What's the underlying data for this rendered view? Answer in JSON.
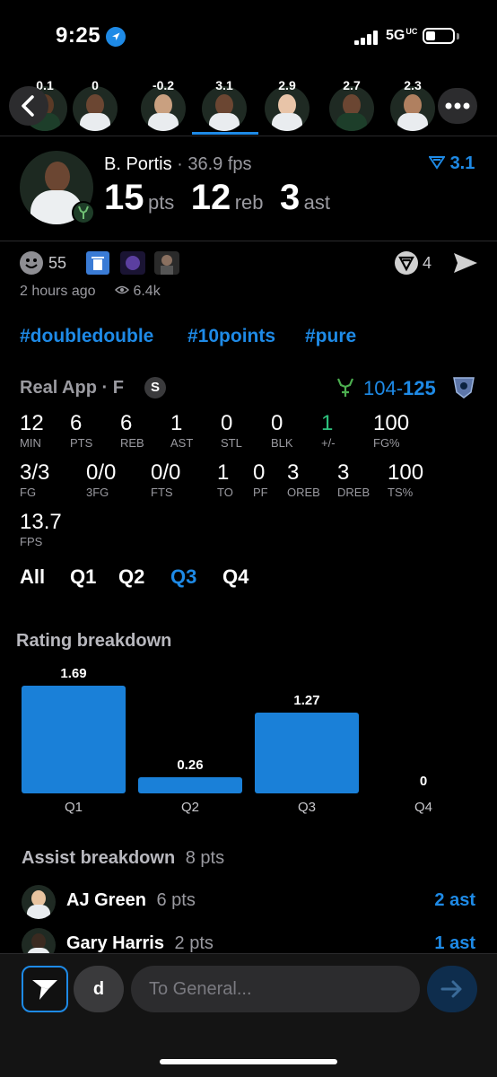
{
  "status_bar": {
    "time": "9:25",
    "network": "5G",
    "network_suffix": "UC"
  },
  "player_strip": {
    "values": [
      "0.1",
      "0",
      "-0.2",
      "3.1",
      "2.9",
      "2.7",
      "2.3"
    ],
    "active_index": 3
  },
  "player": {
    "name": "B. Portis",
    "separator": "·",
    "fps": "36.9 fps",
    "rating": "3.1",
    "pts_value": "15",
    "pts_label": "pts",
    "reb_value": "12",
    "reb_label": "reb",
    "ast_value": "3",
    "ast_label": "ast"
  },
  "social": {
    "reactions_count": "55",
    "shares_count": "4",
    "posted": "2 hours ago",
    "views": "6.4k"
  },
  "hashtags": [
    "#doubledouble",
    "#10points",
    "#pure"
  ],
  "game": {
    "league": "Real App",
    "separator": "·",
    "position": "F",
    "badge": "S",
    "score_home": "104",
    "score_dash": "-",
    "score_away": "125"
  },
  "stats_row1": [
    {
      "value": "12",
      "label": "MIN"
    },
    {
      "value": "6",
      "label": "PTS"
    },
    {
      "value": "6",
      "label": "REB"
    },
    {
      "value": "1",
      "label": "AST"
    },
    {
      "value": "0",
      "label": "STL"
    },
    {
      "value": "0",
      "label": "BLK"
    },
    {
      "value": "1",
      "label": "+/-"
    },
    {
      "value": "100",
      "label": "FG%"
    }
  ],
  "stats_row2": [
    {
      "value": "3/3",
      "label": "FG"
    },
    {
      "value": "0/0",
      "label": "3FG"
    },
    {
      "value": "0/0",
      "label": "FTS"
    },
    {
      "value": "1",
      "label": "TO"
    },
    {
      "value": "0",
      "label": "PF"
    },
    {
      "value": "3",
      "label": "OREB"
    },
    {
      "value": "3",
      "label": "DREB"
    },
    {
      "value": "100",
      "label": "TS%"
    }
  ],
  "stats_row3": [
    {
      "value": "13.7",
      "label": "FPS"
    }
  ],
  "period_tabs": [
    "All",
    "Q1",
    "Q2",
    "Q3",
    "Q4"
  ],
  "active_period": "Q3",
  "rating_breakdown": {
    "title": "Rating breakdown"
  },
  "chart_data": {
    "type": "bar",
    "categories": [
      "Q1",
      "Q2",
      "Q3",
      "Q4"
    ],
    "values": [
      1.69,
      0.26,
      1.27,
      0
    ],
    "value_labels": [
      "1.69",
      "0.26",
      "1.27",
      "0"
    ],
    "title": "Rating breakdown",
    "xlabel": "",
    "ylabel": "",
    "ylim": [
      0,
      1.69
    ],
    "grid": false,
    "bar_color": "#1a80d8"
  },
  "assist_breakdown": {
    "title": "Assist breakdown",
    "total": "8 pts",
    "rows": [
      {
        "name": "AJ Green",
        "pts": "6 pts",
        "ast": "2 ast"
      },
      {
        "name": "Gary Harris",
        "pts": "2 pts",
        "ast": "1 ast"
      }
    ]
  },
  "composer": {
    "user_initial": "d",
    "placeholder": "To General..."
  },
  "colors": {
    "accent": "#1e8ae6",
    "positive": "#2ec27e",
    "bg": "#000000"
  }
}
